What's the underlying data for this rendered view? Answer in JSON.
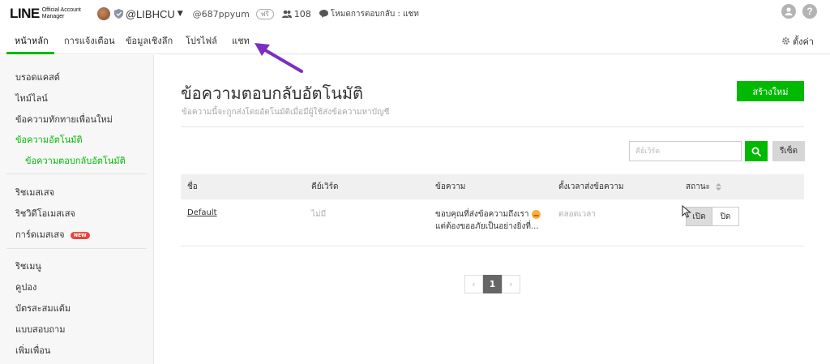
{
  "header": {
    "logo_main": "LINE",
    "logo_sub_1": "Official Account",
    "logo_sub_2": "Manager",
    "account_name": "@LIBHCU",
    "account_id": "@687ppyum",
    "plan_badge": "ฟรี",
    "friend_count": "108",
    "response_mode": "โหมดการตอบกลับ : แชท",
    "icons": [
      "avatar",
      "shield-icon",
      "chevron-down-icon",
      "friends-icon",
      "chat-bubble-icon",
      "user-icon",
      "help-icon"
    ]
  },
  "nav": {
    "items": [
      {
        "label": "หน้าหลัก",
        "active": true
      },
      {
        "label": "การแจ้งเตือน"
      },
      {
        "label": "ข้อมูลเชิงลึก"
      },
      {
        "label": "โปรไฟล์"
      },
      {
        "label": "แชท"
      }
    ],
    "settings_label": "ตั้งค่า",
    "accent_color": "#00b900",
    "annotation_arrow_color": "#7b2fbf"
  },
  "sidebar": {
    "items": [
      {
        "label": "บรอดแคสต์"
      },
      {
        "label": "ไทม์ไลน์"
      },
      {
        "label": "ข้อความทักทายเพื่อนใหม่"
      },
      {
        "label": "ข้อความอัตโนมัติ",
        "active": true
      },
      {
        "label": "ข้อความตอบกลับอัตโนมัติ",
        "sub": true,
        "active": true
      },
      {
        "label": "ริชเมสเสจ"
      },
      {
        "label": "ริชวิดีโอเมสเสจ"
      },
      {
        "label": "การ์ดเมสเสจ",
        "badge": "NEW"
      },
      {
        "label": "ริชเมนู"
      },
      {
        "label": "คูปอง"
      },
      {
        "label": "บัตรสะสมแต้ม"
      },
      {
        "label": "แบบสอบถาม"
      },
      {
        "label": "เพิ่มเพื่อน"
      }
    ]
  },
  "main": {
    "title": "ข้อความตอบกลับอัตโนมัติ",
    "description": "ข้อความนี้จะถูกส่งโดยอัตโนมัติเมื่อมีผู้ใช้ส่งข้อความหาบัญชี",
    "create_label": "สร้างใหม่",
    "search_placeholder": "คีย์เวิร์ด",
    "reset_label": "รีเซ็ต"
  },
  "table": {
    "headers": [
      "ชื่อ",
      "คีย์เวิร์ด",
      "ข้อความ",
      "ตั้งเวลาส่งข้อความ",
      "สถานะ"
    ],
    "rows": [
      {
        "name": "Default",
        "keyword": "ไม่มี",
        "message_line1": "ขอบคุณที่ส่งข้อความถึงเรา",
        "message_line2": "แต่ต้องขออภัยเป็นอย่างยิ่งที่...",
        "schedule": "ตลอดเวลา",
        "status_on_label": "เปิด",
        "status_off_label": "ปิด",
        "status": "on"
      }
    ]
  },
  "pagination": {
    "prev": "‹",
    "current": "1",
    "next": "›"
  }
}
